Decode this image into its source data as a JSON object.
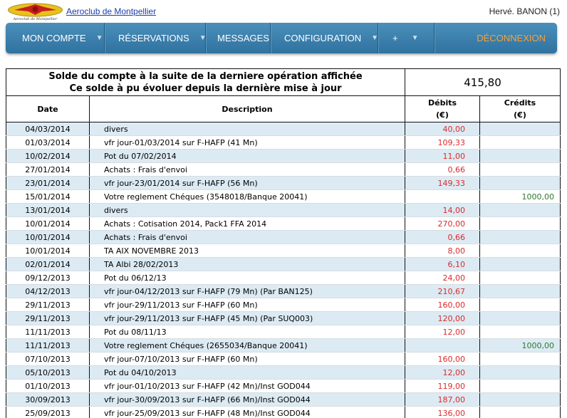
{
  "header": {
    "site_name": "Aeroclub de Montpellier",
    "logo_text": "Aeroclub de Montpellier",
    "user": "Hervé. BANON (1)"
  },
  "nav": {
    "items": [
      {
        "label": "MON COMPTE",
        "dropdown": true
      },
      {
        "label": "RÉSERVATIONS",
        "dropdown": true
      },
      {
        "label": "MESSAGES",
        "dropdown": false
      },
      {
        "label": "CONFIGURATION",
        "dropdown": true
      },
      {
        "label": "+",
        "dropdown": true
      }
    ],
    "logout": "DÉCONNEXION"
  },
  "balance": {
    "label_line1": "Solde du compte à la suite de la derniere opération affichée",
    "label_line2": "Ce solde à pu évoluer depuis la dernière mise à jour",
    "value": "415,80"
  },
  "table": {
    "columns": {
      "date": "Date",
      "description": "Description",
      "debits": "Débits",
      "debits_unit": "(€)",
      "credits": "Crédits",
      "credits_unit": "(€)"
    },
    "rows": [
      {
        "date": "04/03/2014",
        "desc": "divers",
        "debit": "40,00",
        "credit": ""
      },
      {
        "date": "01/03/2014",
        "desc": "vfr jour-01/03/2014 sur F-HAFP (41 Mn)",
        "debit": "109,33",
        "credit": ""
      },
      {
        "date": "10/02/2014",
        "desc": "Pot du 07/02/2014",
        "debit": "11,00",
        "credit": ""
      },
      {
        "date": "27/01/2014",
        "desc": "Achats : Frais d'envoi",
        "debit": "0,66",
        "credit": ""
      },
      {
        "date": "23/01/2014",
        "desc": "vfr jour-23/01/2014 sur F-HAFP (56 Mn)",
        "debit": "149,33",
        "credit": ""
      },
      {
        "date": "15/01/2014",
        "desc": "Votre reglement Chéques (3548018/Banque 20041)",
        "debit": "",
        "credit": "1000,00"
      },
      {
        "date": "13/01/2014",
        "desc": "divers",
        "debit": "14,00",
        "credit": ""
      },
      {
        "date": "10/01/2014",
        "desc": "Achats : Cotisation 2014, Pack1 FFA 2014",
        "debit": "270,00",
        "credit": ""
      },
      {
        "date": "10/01/2014",
        "desc": "Achats : Frais d'envoi",
        "debit": "0,66",
        "credit": ""
      },
      {
        "date": "10/01/2014",
        "desc": "TA AIX NOVEMBRE 2013",
        "debit": "8,00",
        "credit": ""
      },
      {
        "date": "02/01/2014",
        "desc": "TA Albi 28/02/2013",
        "debit": "6,10",
        "credit": ""
      },
      {
        "date": "09/12/2013",
        "desc": "Pot du 06/12/13",
        "debit": "24,00",
        "credit": ""
      },
      {
        "date": "04/12/2013",
        "desc": "vfr jour-04/12/2013 sur F-HAFP (79 Mn) (Par BAN125)",
        "debit": "210,67",
        "credit": ""
      },
      {
        "date": "29/11/2013",
        "desc": "vfr jour-29/11/2013 sur F-HAFP (60 Mn)",
        "debit": "160,00",
        "credit": ""
      },
      {
        "date": "29/11/2013",
        "desc": "vfr jour-29/11/2013 sur F-HAFP (45 Mn) (Par SUQ003)",
        "debit": "120,00",
        "credit": ""
      },
      {
        "date": "11/11/2013",
        "desc": "Pot du 08/11/13",
        "debit": "12,00",
        "credit": ""
      },
      {
        "date": "11/11/2013",
        "desc": "Votre reglement Chéques (2655034/Banque 20041)",
        "debit": "",
        "credit": "1000,00"
      },
      {
        "date": "07/10/2013",
        "desc": "vfr jour-07/10/2013 sur F-HAFP (60 Mn)",
        "debit": "160,00",
        "credit": ""
      },
      {
        "date": "05/10/2013",
        "desc": "Pot du 04/10/2013",
        "debit": "12,00",
        "credit": ""
      },
      {
        "date": "01/10/2013",
        "desc": "vfr jour-01/10/2013 sur F-HAFP (42 Mn)/Inst GOD044",
        "debit": "119,00",
        "credit": ""
      },
      {
        "date": "30/09/2013",
        "desc": "vfr jour-30/09/2013 sur F-HAFP (66 Mn)/Inst GOD044",
        "debit": "187,00",
        "credit": ""
      },
      {
        "date": "25/09/2013",
        "desc": "vfr jour-25/09/2013 sur F-HAFP (48 Mn)/Inst GOD044",
        "debit": "136,00",
        "credit": ""
      }
    ]
  },
  "colors": {
    "nav_bg": "#3a7fae",
    "logout": "#f6a23a",
    "debit": "#d92b2b",
    "credit": "#2d7a2d",
    "row_alt": "#dceaf3"
  }
}
